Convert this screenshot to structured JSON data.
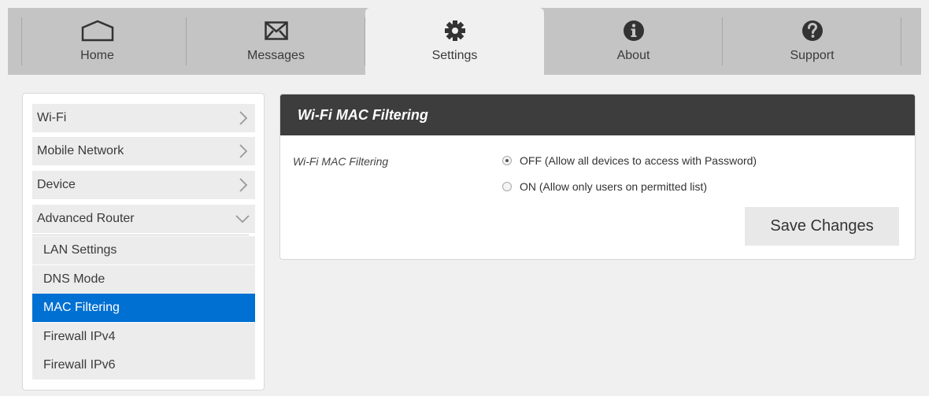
{
  "nav": {
    "tabs": [
      {
        "label": "Home",
        "icon": "home-icon",
        "active": false
      },
      {
        "label": "Messages",
        "icon": "envelope-icon",
        "active": false
      },
      {
        "label": "Settings",
        "icon": "gear-icon",
        "active": true
      },
      {
        "label": "About",
        "icon": "info-icon",
        "active": false
      },
      {
        "label": "Support",
        "icon": "question-icon",
        "active": false
      }
    ]
  },
  "sidebar": {
    "items": [
      {
        "label": "Wi-Fi",
        "icon": "chevron-right-icon"
      },
      {
        "label": "Mobile Network",
        "icon": "chevron-right-icon"
      },
      {
        "label": "Device",
        "icon": "chevron-right-icon"
      },
      {
        "label": "Advanced Router",
        "icon": "chevron-down-icon",
        "expanded": true
      }
    ],
    "subitems": [
      {
        "label": "LAN Settings",
        "active": false
      },
      {
        "label": "DNS Mode",
        "active": false
      },
      {
        "label": "MAC Filtering",
        "active": true
      },
      {
        "label": "Firewall IPv4",
        "active": false
      },
      {
        "label": "Firewall IPv6",
        "active": false
      }
    ]
  },
  "panel": {
    "title": "Wi-Fi MAC Filtering",
    "field_label": "Wi-Fi MAC Filtering",
    "options": [
      {
        "label": "OFF (Allow all devices to access with Password)",
        "selected": true
      },
      {
        "label": "ON (Allow only users on permitted list)",
        "selected": false
      }
    ],
    "save_label": "Save Changes"
  },
  "colors": {
    "nav_bg": "#c4c4c4",
    "page_bg": "#f0f0f0",
    "header_bg": "#3d3d3d",
    "active_blue": "#0070d2",
    "menu_bg": "#ececec"
  }
}
